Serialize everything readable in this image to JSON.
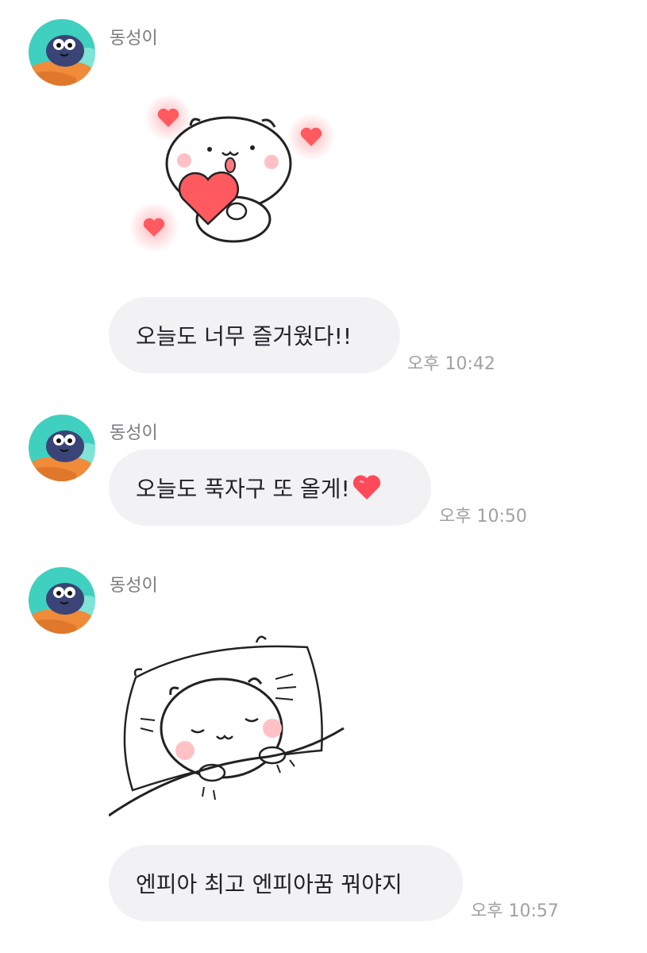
{
  "messages": [
    {
      "sender": "동성이"
    },
    {
      "text": "오늘도 너무 즐거웠다!!",
      "time": "오후 10:42"
    },
    {
      "sender": "동성이",
      "text": "오늘도 푹자구 또 올게!",
      "time": "오후 10:50"
    },
    {
      "sender": "동성이"
    },
    {
      "text": "엔피아 최고 엔피아꿈 꿔야지",
      "time": "오후 10:57"
    }
  ],
  "colors": {
    "bubble": "#f2f2f5",
    "heart": "#ff5a5f",
    "avatar_bg": "#3fd0c0"
  }
}
